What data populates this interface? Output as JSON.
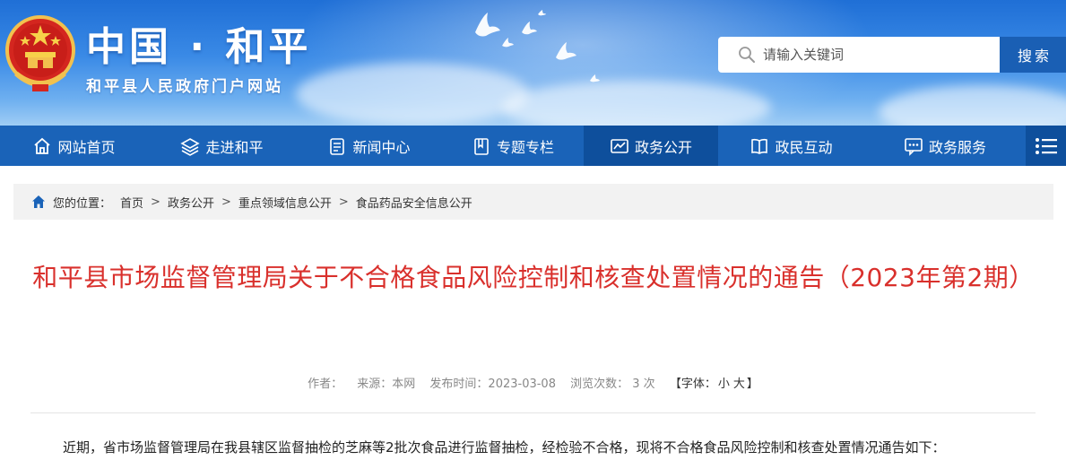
{
  "header": {
    "site_title": "中国 · 和平",
    "site_subtitle": "和平县人民政府门户网站",
    "emblem_icon": "national-emblem-icon",
    "colors": {
      "sky_top": "#1f6fd6",
      "sky_bottom": "#9fcdf5"
    }
  },
  "search": {
    "placeholder": "请输入关键词",
    "value": "",
    "button_label": "搜索",
    "icon": "search-icon"
  },
  "nav": {
    "items": [
      {
        "label": "网站首页",
        "icon": "home-icon",
        "active": false
      },
      {
        "label": "走进和平",
        "icon": "layers-icon",
        "active": false
      },
      {
        "label": "新闻中心",
        "icon": "news-icon",
        "active": false
      },
      {
        "label": "专题专栏",
        "icon": "bookmark-icon",
        "active": false
      },
      {
        "label": "政务公开",
        "icon": "chart-icon",
        "active": true
      },
      {
        "label": "政民互动",
        "icon": "book-icon",
        "active": false
      },
      {
        "label": "政务服务",
        "icon": "service-icon",
        "active": false
      }
    ],
    "menu_icon": "menu-icon",
    "colors": {
      "bar": "#1a63b8",
      "active": "#0e4f9c"
    }
  },
  "breadcrumb": {
    "label": "您的位置：",
    "items": [
      "首页",
      "政务公开",
      "重点领域信息公开",
      "食品药品安全信息公开"
    ],
    "separator": ">"
  },
  "article": {
    "title": "和平县市场监督管理局关于不合格食品风险控制和核查处置情况的通告（2023年第2期）",
    "title_color": "#d9302c",
    "meta": {
      "author_label": "作者：",
      "source": "来源：本网",
      "publish_time": "发布时间：2023-03-08",
      "views": "浏览次数： 3 次",
      "font_prefix": "【字体：",
      "font_small": "小",
      "font_large": "大",
      "font_suffix": "】"
    },
    "body_first_line": "近期，省市场监督管理局在我县辖区监督抽检的芝麻等2批次食品进行监督抽检，经检验不合格，现将不合格食品风险控制和核查处置情况通告如下："
  }
}
